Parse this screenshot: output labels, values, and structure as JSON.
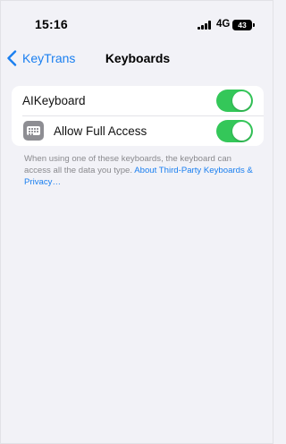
{
  "status_bar": {
    "time": "15:16",
    "network": "4G",
    "battery_level": "43",
    "icons": [
      "signal-bars-icon",
      "battery-icon"
    ]
  },
  "nav": {
    "back_label": "KeyTrans",
    "title": "Keyboards",
    "back_icon": "chevron-left-icon"
  },
  "settings_rows": [
    {
      "label": "AIKeyboard",
      "toggle_on": true
    },
    {
      "label": "Allow Full Access",
      "toggle_on": true,
      "icon": "keyboard-icon"
    }
  ],
  "footer": {
    "text": "When using one of these keyboards, the keyboard can access all the data you type.",
    "link": "About Third-Party Keyboards & Privacy…"
  },
  "colors": {
    "accent": "#1a7ff0",
    "toggle_on": "#34c759",
    "background": "#f2f2f7",
    "footer_text": "#8a8a8e"
  }
}
